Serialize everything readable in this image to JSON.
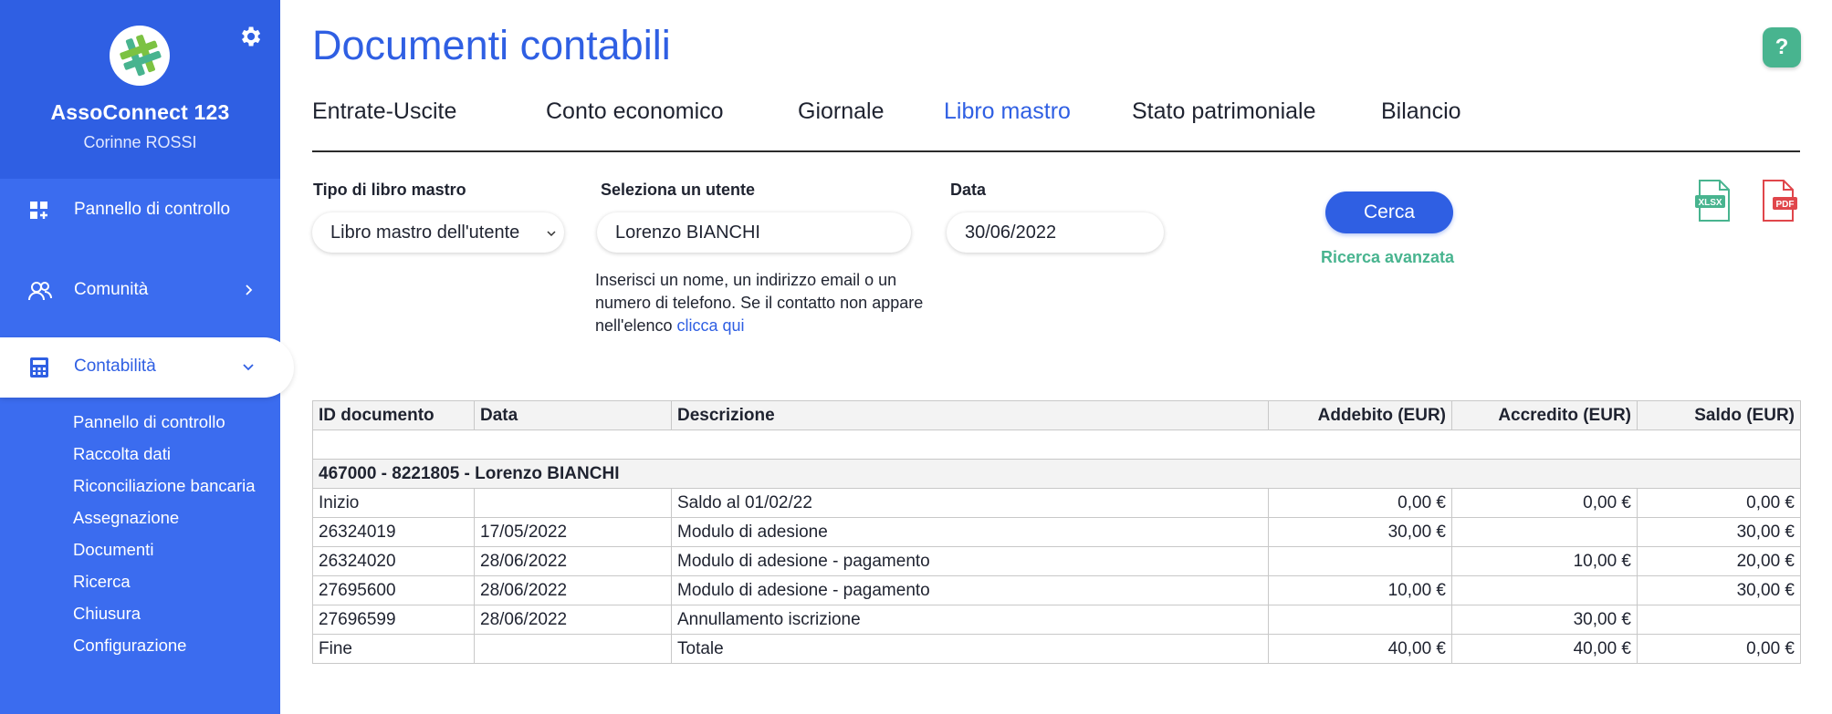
{
  "sidebar": {
    "org_name": "AssoConnect 123",
    "user_name": "Corinne ROSSI",
    "nav": [
      {
        "label": "Pannello di controllo",
        "icon": "dashboard-icon"
      },
      {
        "label": "Comunità",
        "icon": "people-icon"
      },
      {
        "label": "Contabilità",
        "icon": "calculator-icon"
      }
    ],
    "sub_items": [
      "Pannello di controllo",
      "Raccolta dati",
      "Riconciliazione bancaria",
      "Assegnazione",
      "Documenti",
      "Ricerca",
      "Chiusura",
      "Configurazione"
    ]
  },
  "page": {
    "title": "Documenti contabili",
    "help_label": "?"
  },
  "tabs": [
    {
      "label": "Entrate-Uscite"
    },
    {
      "label": "Conto economico"
    },
    {
      "label": "Giornale"
    },
    {
      "label": "Libro mastro",
      "active": true
    },
    {
      "label": "Stato patrimoniale"
    },
    {
      "label": "Bilancio"
    }
  ],
  "filters": {
    "ledger_type_label": "Tipo di libro mastro",
    "ledger_type_value": "Libro mastro dell'utente",
    "user_label": "Seleziona un utente",
    "user_value": "Lorenzo BIANCHI",
    "date_label": "Data",
    "date_value": "30/06/2022",
    "help_text": "Inserisci un nome, un indirizzo email o un numero di telefono. Se il contatto non appare nell'elenco",
    "help_link": "clicca qui",
    "search_label": "Cerca",
    "advanced_search_label": "Ricerca avanzata",
    "export_xlsx_label": "XLSX",
    "export_pdf_label": "PDF"
  },
  "table": {
    "headers": [
      "ID documento",
      "Data",
      "Descrizione",
      "Addebito (EUR)",
      "Accredito (EUR)",
      "Saldo (EUR)"
    ],
    "group_title": "467000 - 8221805 - Lorenzo BIANCHI",
    "rows": [
      [
        "Inizio",
        "",
        "Saldo al 01/02/22",
        "0,00 €",
        "0,00 €",
        "0,00 €"
      ],
      [
        "26324019",
        "17/05/2022",
        "Modulo di adesione",
        "30,00 €",
        "",
        "30,00 €"
      ],
      [
        "26324020",
        "28/06/2022",
        "Modulo di adesione - pagamento",
        "",
        "10,00 €",
        "20,00 €"
      ],
      [
        "27695600",
        "28/06/2022",
        "Modulo di adesione - pagamento",
        "10,00 €",
        "",
        "30,00 €"
      ],
      [
        "27696599",
        "28/06/2022",
        "Annullamento iscrizione",
        "",
        "30,00 €",
        ""
      ],
      [
        "Fine",
        "",
        "Totale",
        "40,00 €",
        "40,00 €",
        "0,00 €"
      ]
    ]
  },
  "colors": {
    "brand_blue": "#2f5fe3",
    "sidebar_blue": "#3b6cef",
    "accent_green": "#48b48f",
    "pdf_red": "#e0464b"
  }
}
